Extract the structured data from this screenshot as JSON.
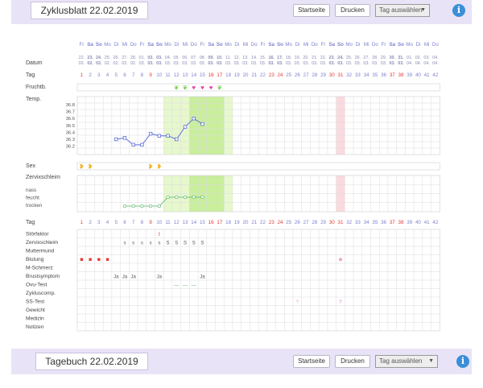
{
  "header": {
    "title": "Zyklusblatt 22.02.2019",
    "home_label": "Startseite",
    "print_label": "Drucken",
    "select_value": "Tag auswählen",
    "info_icon": "i"
  },
  "footer": {
    "title": "Tagebuch 22.02.2019",
    "home_label": "Startseite",
    "print_label": "Drucken",
    "select_value": "Tag auswählen",
    "info_icon": "i"
  },
  "colors": {
    "accent": "#3a8fd8",
    "bar": "#e9e3f7",
    "fertile_light": "#e6f8cc",
    "fertile_strong": "#c9ee9c",
    "period_marker": "#fadadd",
    "temp_line": "#5e6fd6",
    "mucus_line": "#55b46b",
    "bleeding": "#e53935",
    "weekday_blue": "#8080d0"
  },
  "chart": {
    "weekday_labels": [
      "Fr",
      "Sa",
      "So",
      "Mo",
      "Di",
      "Mi",
      "Do",
      "Fr",
      "Sa",
      "So",
      "Mo",
      "Di",
      "Mi",
      "Do",
      "Fr",
      "Sa",
      "So",
      "Mo",
      "Di",
      "Mi",
      "Do",
      "Fr",
      "Sa",
      "So",
      "Mo",
      "Di",
      "Mi",
      "Do",
      "Fr",
      "Sa",
      "So",
      "Mo",
      "Di",
      "Mi",
      "Do",
      "Fr",
      "Sa",
      "So",
      "Mo",
      "Di",
      "Mi",
      "Do"
    ],
    "date_days": [
      "22.",
      "23.",
      "24.",
      "25.",
      "26.",
      "27.",
      "28.",
      "01.",
      "02.",
      "03.",
      "04.",
      "05.",
      "06.",
      "07.",
      "08.",
      "09.",
      "10.",
      "11.",
      "12.",
      "13.",
      "14.",
      "15.",
      "16.",
      "17.",
      "18.",
      "19.",
      "20.",
      "21.",
      "22.",
      "23.",
      "24.",
      "25.",
      "26.",
      "27.",
      "28.",
      "29.",
      "30.",
      "31.",
      "01.",
      "02.",
      "03.",
      "04."
    ],
    "date_months": [
      "02.",
      "02.",
      "02.",
      "02.",
      "02.",
      "02.",
      "02.",
      "03.",
      "03.",
      "03.",
      "03.",
      "03.",
      "03.",
      "03.",
      "03.",
      "03.",
      "03.",
      "03.",
      "03.",
      "03.",
      "03.",
      "03.",
      "03.",
      "03.",
      "03.",
      "03.",
      "03.",
      "03.",
      "03.",
      "03.",
      "03.",
      "03.",
      "03.",
      "03.",
      "03.",
      "03.",
      "03.",
      "03.",
      "04.",
      "04.",
      "04.",
      "04."
    ],
    "row_labels": {
      "datum": "Datum",
      "tag": "Tag",
      "fruchtb": "Fruchtb.",
      "temp": "Temp.",
      "sex": "Sex",
      "zervix": "Zervixschleim",
      "tag2": "Tag"
    },
    "mucus_labels": [
      "nass",
      "feucht",
      "trocken"
    ],
    "temp_ticks": [
      "36.8",
      "36.7",
      "36.6",
      "36.5",
      "36.4",
      "36.3",
      "36.2"
    ],
    "temperature_points": [
      {
        "day": 5,
        "temp": 36.3
      },
      {
        "day": 6,
        "temp": 36.32
      },
      {
        "day": 7,
        "temp": 36.22
      },
      {
        "day": 8,
        "temp": 36.22
      },
      {
        "day": 9,
        "temp": 36.38
      },
      {
        "day": 10,
        "temp": 36.35
      },
      {
        "day": 11,
        "temp": 36.35
      },
      {
        "day": 12,
        "temp": 36.3
      },
      {
        "day": 13,
        "temp": 36.48
      },
      {
        "day": 14,
        "temp": 36.6
      },
      {
        "day": 15,
        "temp": 36.52
      }
    ],
    "mucus_points": [
      {
        "day": 6,
        "level": 0
      },
      {
        "day": 7,
        "level": 0
      },
      {
        "day": 8,
        "level": 0
      },
      {
        "day": 9,
        "level": 0
      },
      {
        "day": 10,
        "level": 0
      },
      {
        "day": 11,
        "level": 1
      },
      {
        "day": 12,
        "level": 1
      },
      {
        "day": 13,
        "level": 1
      },
      {
        "day": 14,
        "level": 1
      },
      {
        "day": 15,
        "level": 1
      }
    ],
    "fertile_light_days": [
      11,
      18
    ],
    "fertile_strong_days": [
      14,
      17
    ],
    "period_marker_day": 31,
    "fruchtb_icons": [
      {
        "day": 12,
        "type": "leaf"
      },
      {
        "day": 13,
        "type": "leaf"
      },
      {
        "day": 14,
        "type": "heart"
      },
      {
        "day": 15,
        "type": "heart"
      },
      {
        "day": 16,
        "type": "heart"
      },
      {
        "day": 17,
        "type": "leaf"
      }
    ],
    "sex_days": [
      1,
      2,
      9,
      10
    ],
    "red_days": [
      1,
      9,
      16,
      17,
      23,
      24,
      30,
      31,
      37,
      38
    ],
    "bold_days": [
      2,
      3,
      9,
      10,
      16,
      17,
      23,
      24,
      30,
      31,
      37,
      38
    ],
    "tag_numbers_count": 42,
    "symptom_labels": [
      "Störfaktor",
      "Zervixschleim",
      "Muttermund",
      "Blutung",
      "M-Schmerz",
      "Brustsymptom",
      "Ovu-Test",
      "Zykluscomp.",
      "SS-Test",
      "Gewicht",
      "Medizin",
      "Notizen"
    ],
    "symptom_marks": [
      {
        "row": 0,
        "day": 10,
        "text": "!",
        "color": "#e53935"
      },
      {
        "row": 1,
        "day": 6,
        "text": "s"
      },
      {
        "row": 1,
        "day": 7,
        "text": "s"
      },
      {
        "row": 1,
        "day": 8,
        "text": "s"
      },
      {
        "row": 1,
        "day": 9,
        "text": "s"
      },
      {
        "row": 1,
        "day": 10,
        "text": "s"
      },
      {
        "row": 1,
        "day": 11,
        "text": "S"
      },
      {
        "row": 1,
        "day": 12,
        "text": "S"
      },
      {
        "row": 1,
        "day": 13,
        "text": "S"
      },
      {
        "row": 1,
        "day": 14,
        "text": "S"
      },
      {
        "row": 1,
        "day": 15,
        "text": "S"
      },
      {
        "row": 3,
        "day": 1,
        "text": "■",
        "color": "#e53935"
      },
      {
        "row": 3,
        "day": 2,
        "text": "■",
        "color": "#e53935"
      },
      {
        "row": 3,
        "day": 3,
        "text": "■",
        "color": "#e53935"
      },
      {
        "row": 3,
        "day": 4,
        "text": "■",
        "color": "#e53935"
      },
      {
        "row": 3,
        "day": 31,
        "text": "■",
        "color": "#f39ab8"
      },
      {
        "row": 5,
        "day": 5,
        "text": "Ja"
      },
      {
        "row": 5,
        "day": 6,
        "text": "Ja"
      },
      {
        "row": 5,
        "day": 7,
        "text": "Ja"
      },
      {
        "row": 5,
        "day": 10,
        "text": "Ja"
      },
      {
        "row": 5,
        "day": 15,
        "text": "Ja"
      },
      {
        "row": 6,
        "day": 12,
        "text": "—",
        "color": "#55b46b"
      },
      {
        "row": 6,
        "day": 13,
        "text": "—",
        "color": "#55b46b"
      },
      {
        "row": 6,
        "day": 14,
        "text": "—",
        "color": "#55b46b"
      },
      {
        "row": 8,
        "day": 26,
        "text": "?",
        "color": "#f39ab8"
      },
      {
        "row": 8,
        "day": 31,
        "text": "?",
        "color": "#e070d0"
      }
    ]
  }
}
